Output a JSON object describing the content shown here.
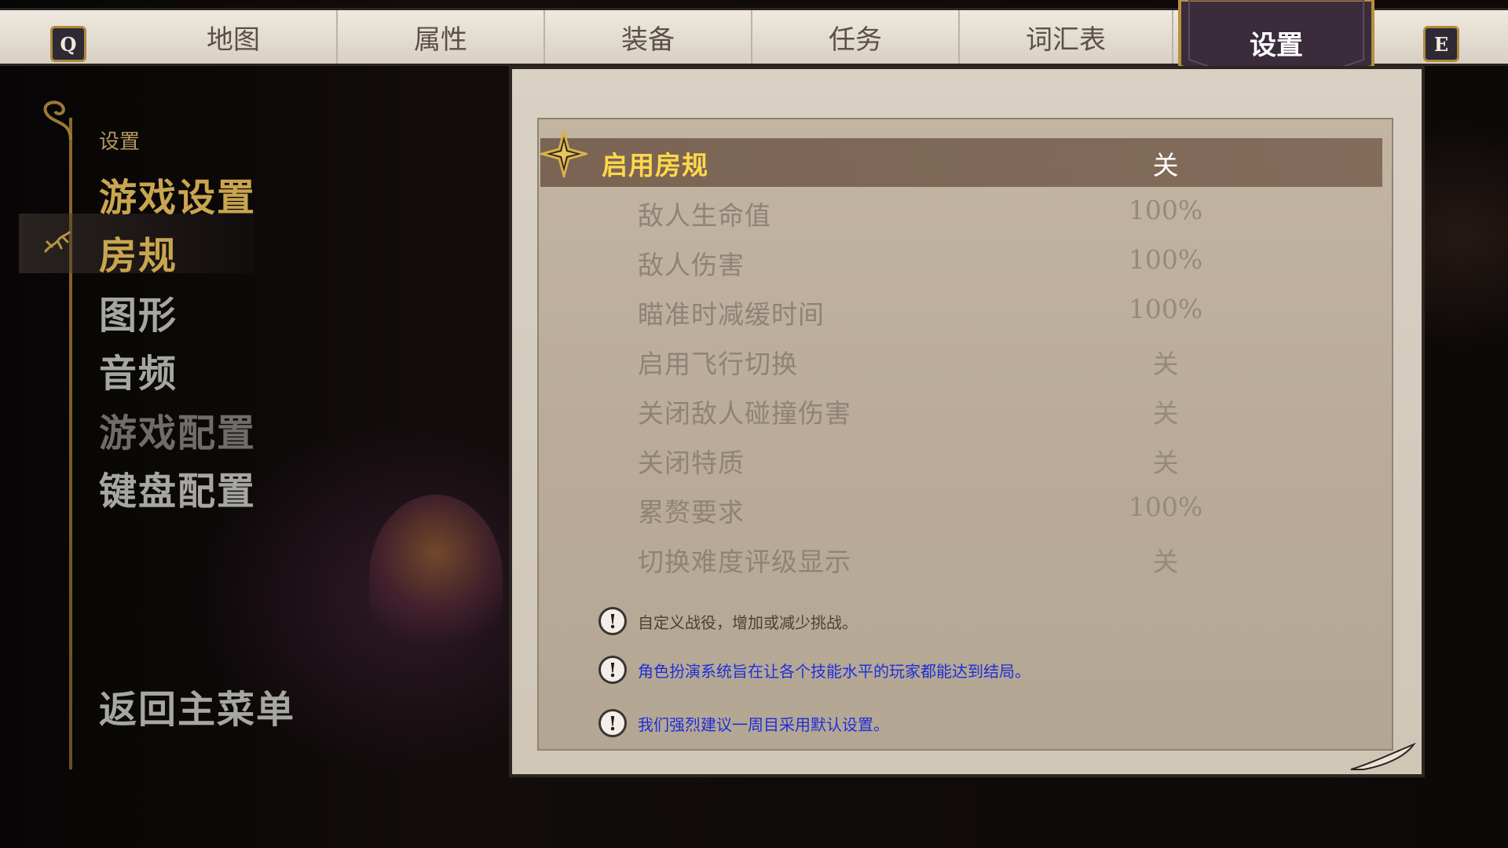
{
  "tabbar": {
    "left_key": "Q",
    "right_key": "E",
    "tabs": [
      {
        "label": "地图"
      },
      {
        "label": "属性"
      },
      {
        "label": "装备"
      },
      {
        "label": "任务"
      },
      {
        "label": "词汇表"
      }
    ],
    "active_tab": "设置"
  },
  "sidebar": {
    "heading": "设置",
    "items": [
      {
        "label": "游戏设置",
        "state": "highlight"
      },
      {
        "label": "房规",
        "state": "selected"
      },
      {
        "label": "图形",
        "state": "normal"
      },
      {
        "label": "音频",
        "state": "normal"
      },
      {
        "label": "游戏配置",
        "state": "disabled"
      },
      {
        "label": "键盘配置",
        "state": "normal"
      }
    ],
    "back_label": "返回主菜单"
  },
  "settings": {
    "rows": [
      {
        "label": "启用房规",
        "value": "关",
        "selected": true
      },
      {
        "label": "敌人生命值",
        "value": "100%"
      },
      {
        "label": "敌人伤害",
        "value": "100%"
      },
      {
        "label": "瞄准时减缓时间",
        "value": "100%"
      },
      {
        "label": "启用飞行切换",
        "value": "关"
      },
      {
        "label": "关闭敌人碰撞伤害",
        "value": "关"
      },
      {
        "label": "关闭特质",
        "value": "关"
      },
      {
        "label": "累赘要求",
        "value": "100%"
      },
      {
        "label": "切换难度评级显示",
        "value": "关"
      }
    ],
    "notes": [
      {
        "text": "自定义战役，增加或减少挑战。",
        "color": "#4d4135"
      },
      {
        "text": "角色扮演系统旨在让各个技能水平的玩家都能达到结局。",
        "color": "#1f2fd8"
      },
      {
        "text": "我们强烈建议一周目采用默认设置。",
        "color": "#1f2fd8"
      }
    ],
    "note_icon": "!"
  },
  "colors": {
    "accent_gold": "#c9a54f",
    "selected_label": "#ffd84a",
    "active_tab_bg": "#3a2c3b",
    "panel_bg": "#c2b5a2"
  },
  "icons": {
    "left_vine": "ornate-vine-icon",
    "selected_marker": "lizard-icon",
    "row_marker": "four-point-star-icon",
    "note": "exclamation-circle-icon",
    "quill": "quill-icon"
  }
}
